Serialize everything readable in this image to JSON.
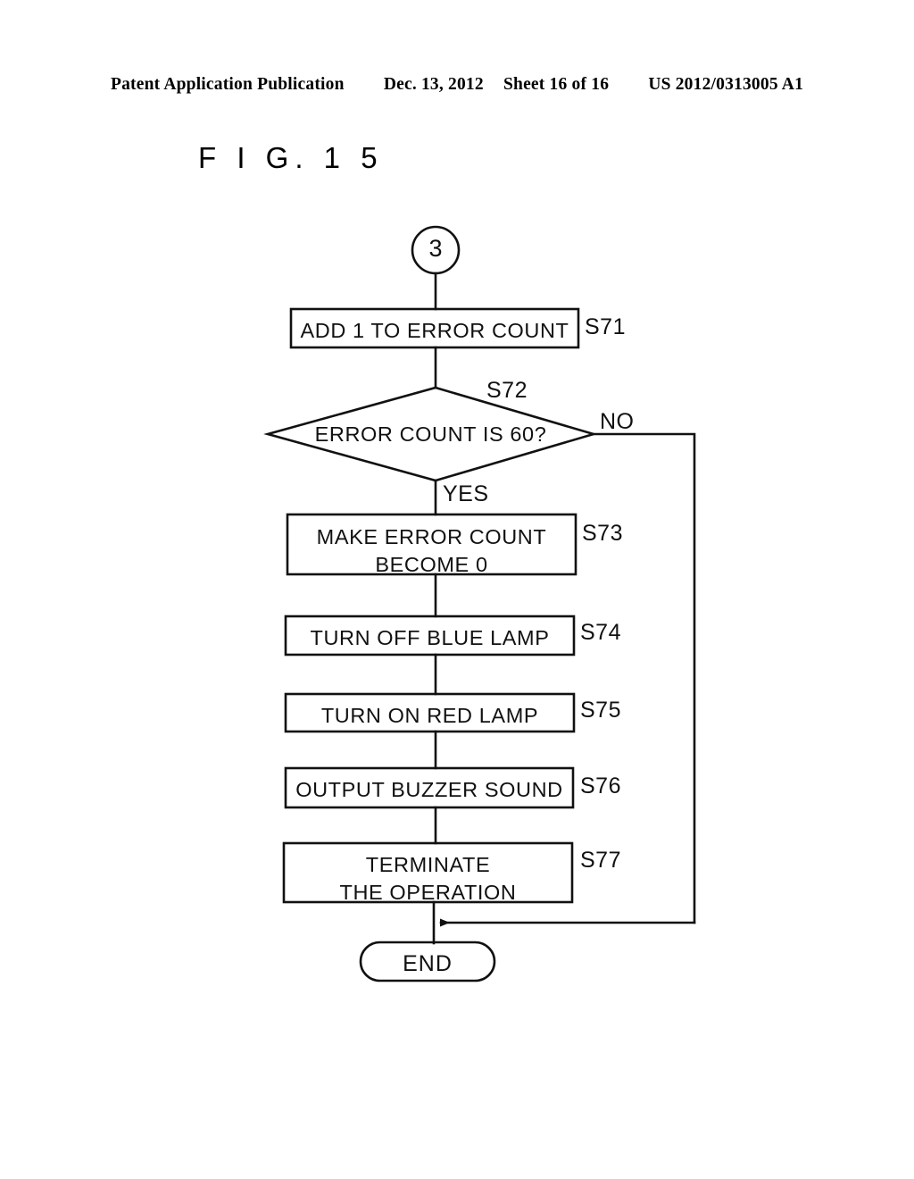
{
  "header": {
    "publication": "Patent Application Publication",
    "date": "Dec. 13, 2012",
    "sheet": "Sheet 16 of 16",
    "number": "US 2012/0313005 A1"
  },
  "figure": {
    "title": "F I G.  1 5"
  },
  "flowchart": {
    "start_connector": {
      "label": "3",
      "shape": "circle"
    },
    "steps": [
      {
        "id": "s71",
        "step_label": "S71",
        "text": "ADD 1 TO ERROR COUNT",
        "shape": "process"
      },
      {
        "id": "s72",
        "step_label": "S72",
        "text": "ERROR COUNT IS 60?",
        "shape": "decision",
        "yes_label": "YES",
        "no_label": "NO"
      },
      {
        "id": "s73",
        "step_label": "S73",
        "text": "MAKE ERROR COUNT\nBECOME 0",
        "shape": "process"
      },
      {
        "id": "s74",
        "step_label": "S74",
        "text": "TURN OFF BLUE LAMP",
        "shape": "process"
      },
      {
        "id": "s75",
        "step_label": "S75",
        "text": "TURN ON RED LAMP",
        "shape": "process"
      },
      {
        "id": "s76",
        "step_label": "S76",
        "text": "OUTPUT BUZZER SOUND",
        "shape": "process"
      },
      {
        "id": "s77",
        "step_label": "S77",
        "text": "TERMINATE\nTHE OPERATION",
        "shape": "process"
      }
    ],
    "end_terminator": {
      "label": "END",
      "shape": "rounded"
    },
    "colors": {
      "ink": "#111111",
      "paper": "#ffffff"
    }
  }
}
